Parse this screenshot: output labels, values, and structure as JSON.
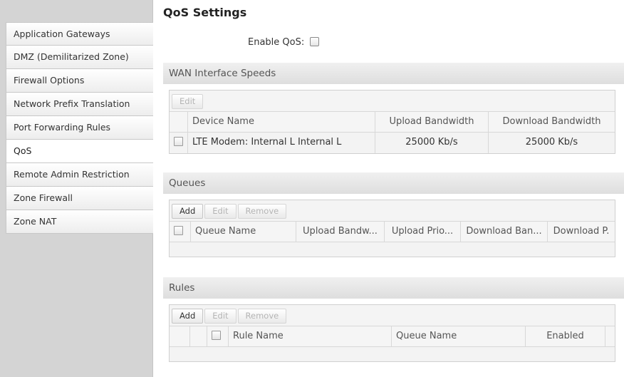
{
  "sidebar": {
    "items": [
      {
        "label": "Application Gateways",
        "active": false
      },
      {
        "label": "DMZ (Demilitarized Zone)",
        "active": false
      },
      {
        "label": "Firewall Options",
        "active": false
      },
      {
        "label": "Network Prefix Translation",
        "active": false
      },
      {
        "label": "Port Forwarding Rules",
        "active": false
      },
      {
        "label": "QoS",
        "active": true
      },
      {
        "label": "Remote Admin Restriction",
        "active": false
      },
      {
        "label": "Zone Firewall",
        "active": false
      },
      {
        "label": "Zone NAT",
        "active": false
      }
    ]
  },
  "page": {
    "title": "QoS Settings",
    "enable_label": "Enable QoS:",
    "enable_checked": false
  },
  "wan": {
    "title": "WAN Interface Speeds",
    "edit_label": "Edit",
    "columns": [
      "Device Name",
      "Upload Bandwidth",
      "Download Bandwidth"
    ],
    "rows": [
      {
        "device": "LTE Modem: Internal L Internal L",
        "upload": "25000 Kb/s",
        "download": "25000 Kb/s"
      }
    ]
  },
  "queues": {
    "title": "Queues",
    "add_label": "Add",
    "edit_label": "Edit",
    "remove_label": "Remove",
    "columns": [
      "Queue Name",
      "Upload Bandw...",
      "Upload Prio...",
      "Download Ban...",
      "Download P."
    ]
  },
  "rules": {
    "title": "Rules",
    "add_label": "Add",
    "edit_label": "Edit",
    "remove_label": "Remove",
    "columns": [
      "Rule Name",
      "Queue Name",
      "Enabled"
    ]
  }
}
